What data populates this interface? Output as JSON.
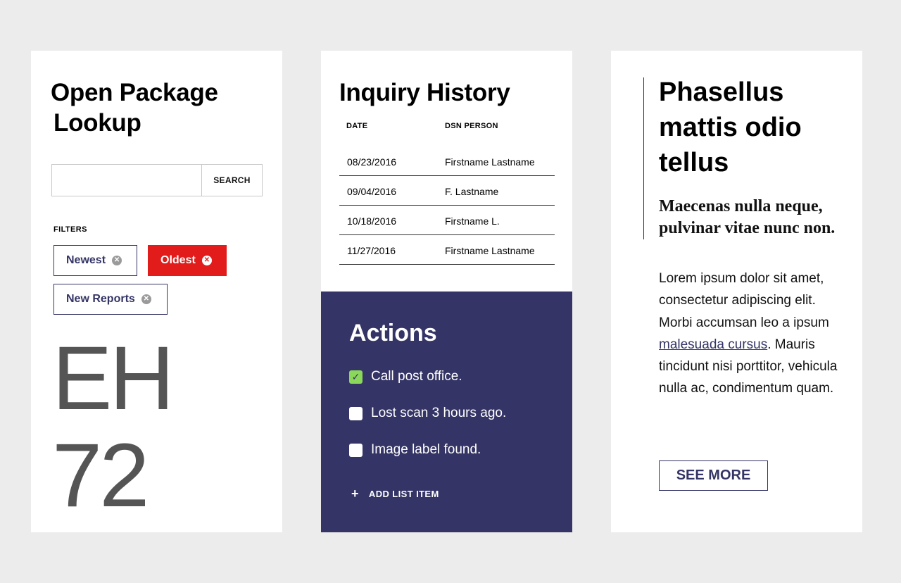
{
  "lookup": {
    "title_line1": "Open Package",
    "title_line2": "Lookup",
    "search_placeholder": "",
    "search_button": "SEARCH",
    "filters_label": "FILTERS",
    "filters": [
      {
        "label": "Newest",
        "active": false
      },
      {
        "label": "Oldest",
        "active": true
      },
      {
        "label": "New Reports",
        "active": false
      }
    ],
    "code_line1": "EH",
    "code_line2": "72"
  },
  "history": {
    "title": "Inquiry History",
    "columns": [
      "DATE",
      "DSN PERSON"
    ],
    "rows": [
      {
        "date": "08/23/2016",
        "person": "Firstname Lastname"
      },
      {
        "date": "09/04/2016",
        "person": "F. Lastname"
      },
      {
        "date": "10/18/2016",
        "person": "Firstname L."
      },
      {
        "date": "11/27/2016",
        "person": "Firstname Lastname"
      }
    ]
  },
  "actions": {
    "title": "Actions",
    "items": [
      {
        "label": "Call post office.",
        "checked": true
      },
      {
        "label": "Lost scan 3 hours ago.",
        "checked": false
      },
      {
        "label": "Image label found.",
        "checked": false
      }
    ],
    "add_label": "ADD LIST ITEM"
  },
  "article": {
    "headline": "Phasellus mattis odio tellus",
    "subhead": "Maecenas nulla neque, pulvinar vitae nunc non.",
    "body_before": "Lorem ipsum dolor sit amet, consectetur adipiscing elit. Morbi accumsan leo a ipsum ",
    "body_link": "malesuada cursus",
    "body_after": ". Mauris tincidunt nisi porttitor, vehicula nulla ac, condimentum quam.",
    "button": "SEE MORE"
  },
  "colors": {
    "background": "#ececec",
    "navy": "#343466",
    "red": "#e21b1b",
    "check_green": "#8ad75a"
  }
}
